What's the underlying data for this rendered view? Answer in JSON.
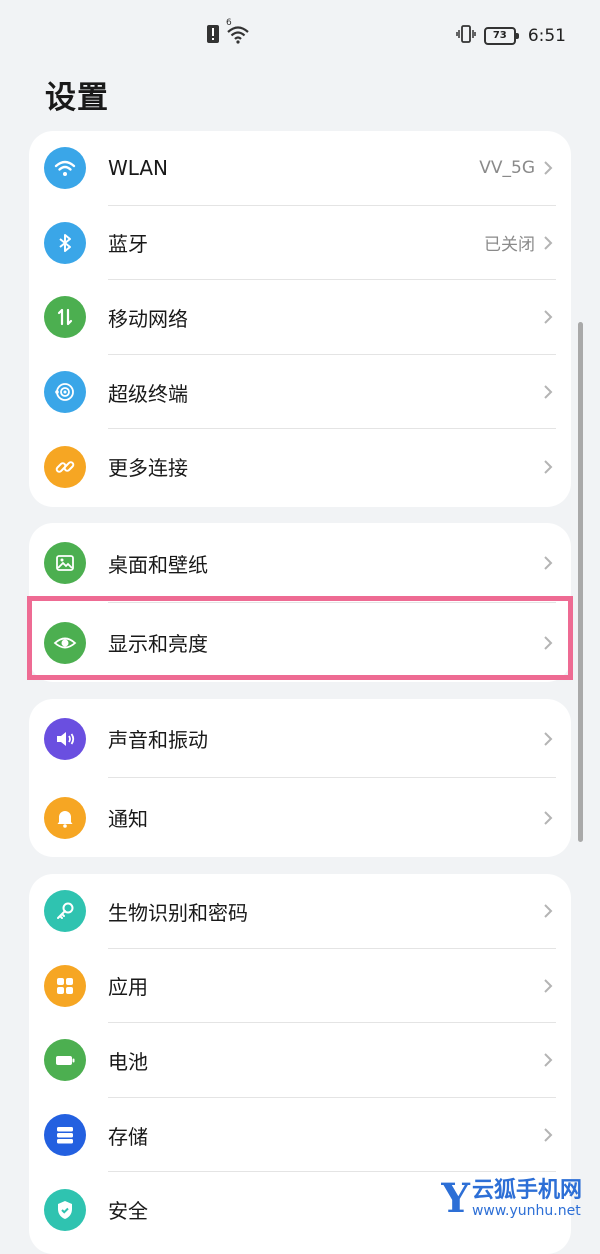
{
  "status_bar": {
    "time": "6:51",
    "battery": "73",
    "signal_badge": "6"
  },
  "title": "设置",
  "groups": [
    {
      "items": [
        {
          "label": "WLAN",
          "value": "VV_5G",
          "icon": "wifi-icon",
          "color": "#3aa6e8"
        },
        {
          "label": "蓝牙",
          "value": "已关闭",
          "icon": "bluetooth-icon",
          "color": "#3aa6e8"
        },
        {
          "label": "移动网络",
          "value": "",
          "icon": "mobile-network-icon",
          "color": "#4caf50"
        },
        {
          "label": "超级终端",
          "value": "",
          "icon": "super-device-icon",
          "color": "#3aa6e8"
        },
        {
          "label": "更多连接",
          "value": "",
          "icon": "link-icon",
          "color": "#f6a623"
        }
      ]
    },
    {
      "items": [
        {
          "label": "桌面和壁纸",
          "value": "",
          "icon": "wallpaper-icon",
          "color": "#4caf50"
        },
        {
          "label": "显示和亮度",
          "value": "",
          "icon": "eye-icon",
          "color": "#4caf50"
        }
      ]
    },
    {
      "items": [
        {
          "label": "声音和振动",
          "value": "",
          "icon": "speaker-icon",
          "color": "#6a4fe0"
        },
        {
          "label": "通知",
          "value": "",
          "icon": "bell-icon",
          "color": "#f6a623"
        }
      ]
    },
    {
      "items": [
        {
          "label": "生物识别和密码",
          "value": "",
          "icon": "key-icon",
          "color": "#2fc3b0"
        },
        {
          "label": "应用",
          "value": "",
          "icon": "apps-icon",
          "color": "#f6a623"
        },
        {
          "label": "电池",
          "value": "",
          "icon": "battery-icon",
          "color": "#4caf50"
        },
        {
          "label": "存储",
          "value": "",
          "icon": "storage-icon",
          "color": "#2360e0"
        },
        {
          "label": "安全",
          "value": "",
          "icon": "shield-icon",
          "color": "#2fc3b0"
        }
      ]
    }
  ],
  "highlight_color": "#ee6b93",
  "watermark": {
    "logo": "Y",
    "text": "云狐手机网",
    "url": "www.yunhu.net"
  }
}
